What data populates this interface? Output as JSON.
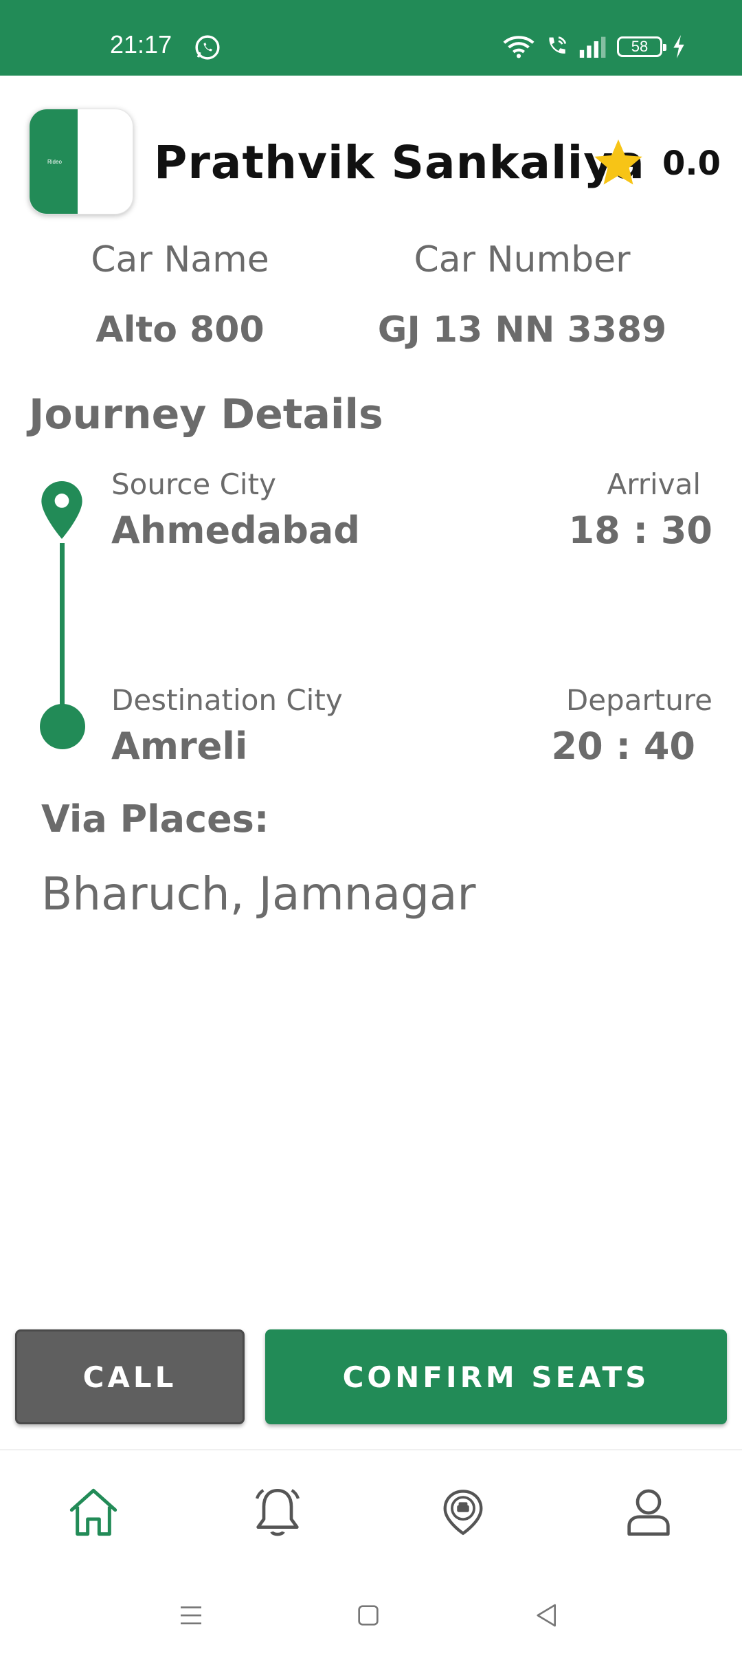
{
  "status_bar": {
    "time": "21:17",
    "battery": "58",
    "icons": [
      "whatsapp-icon",
      "wifi-icon",
      "wifi-call-icon",
      "signal-icon",
      "battery-icon",
      "charging-icon"
    ]
  },
  "driver": {
    "name": "Prathvik Sankaliya",
    "rating": "0.0",
    "logo_text": "Rideo"
  },
  "car": {
    "name_label": "Car Name",
    "name_value": "Alto 800",
    "number_label": "Car Number",
    "number_value": "GJ 13 NN 3389"
  },
  "journey": {
    "title": "Journey Details",
    "source_label": "Source City",
    "source_value": "Ahmedabad",
    "arrival_label": "Arrival",
    "arrival_value": "18 : 30",
    "destination_label": "Destination City",
    "destination_value": "Amreli",
    "departure_label": "Departure",
    "departure_value": "20 : 40",
    "via_label": "Via Places:",
    "via_value": "Bharuch, Jamnagar"
  },
  "actions": {
    "call_label": "CALL",
    "confirm_label": "CONFIRM SEATS"
  },
  "bottom_nav": {
    "items": [
      "home-icon",
      "notifications-icon",
      "rides-icon",
      "profile-icon"
    ],
    "active": "home-icon"
  },
  "colors": {
    "brand_green": "#228b57",
    "text_gray": "#6b6b6b",
    "call_gray": "#5f5f5f",
    "star_yellow": "#f7c416"
  }
}
